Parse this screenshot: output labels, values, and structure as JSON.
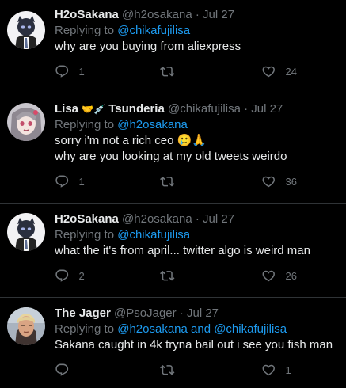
{
  "tweets": [
    {
      "name": "H2oSakana",
      "badges": "",
      "handle": "@h2osakana",
      "date": "Jul 27",
      "replying_prefix": "Replying to",
      "replying_to": "@chikafujilisa",
      "text": "why are you buying from aliexpress",
      "replies": "1",
      "retweets": "",
      "likes": "24"
    },
    {
      "name": "Lisa",
      "badges": "🤝💉",
      "name_suffix": "Tsunderia",
      "handle": "@chikafujilisa",
      "date": "Jul 27",
      "replying_prefix": "Replying to",
      "replying_to": "@h2osakana",
      "text": "sorry i'm not a rich ceo 🥲🙏\nwhy are you looking at my old tweets weirdo",
      "replies": "1",
      "retweets": "",
      "likes": "36"
    },
    {
      "name": "H2oSakana",
      "badges": "",
      "handle": "@h2osakana",
      "date": "Jul 27",
      "replying_prefix": "Replying to",
      "replying_to": "@chikafujilisa",
      "text": "what the it's from april... twitter algo is weird man",
      "replies": "2",
      "retweets": "",
      "likes": "26"
    },
    {
      "name": "The Jager",
      "badges": "",
      "handle": "@PsoJager",
      "date": "Jul 27",
      "replying_prefix": "Replying to",
      "replying_to": "@h2osakana and @chikafujilisa",
      "text": "Sakana caught in 4k tryna bail out i see you fish man",
      "replies": "",
      "retweets": "",
      "likes": "1"
    }
  ],
  "separator": "·",
  "icons": {
    "reply": "reply-icon",
    "retweet": "retweet-icon",
    "like": "heart-icon"
  },
  "colors": {
    "background": "#000000",
    "text": "#e7e9ea",
    "muted": "#71767b",
    "link": "#1d9bf0",
    "divider": "#2f3336"
  }
}
